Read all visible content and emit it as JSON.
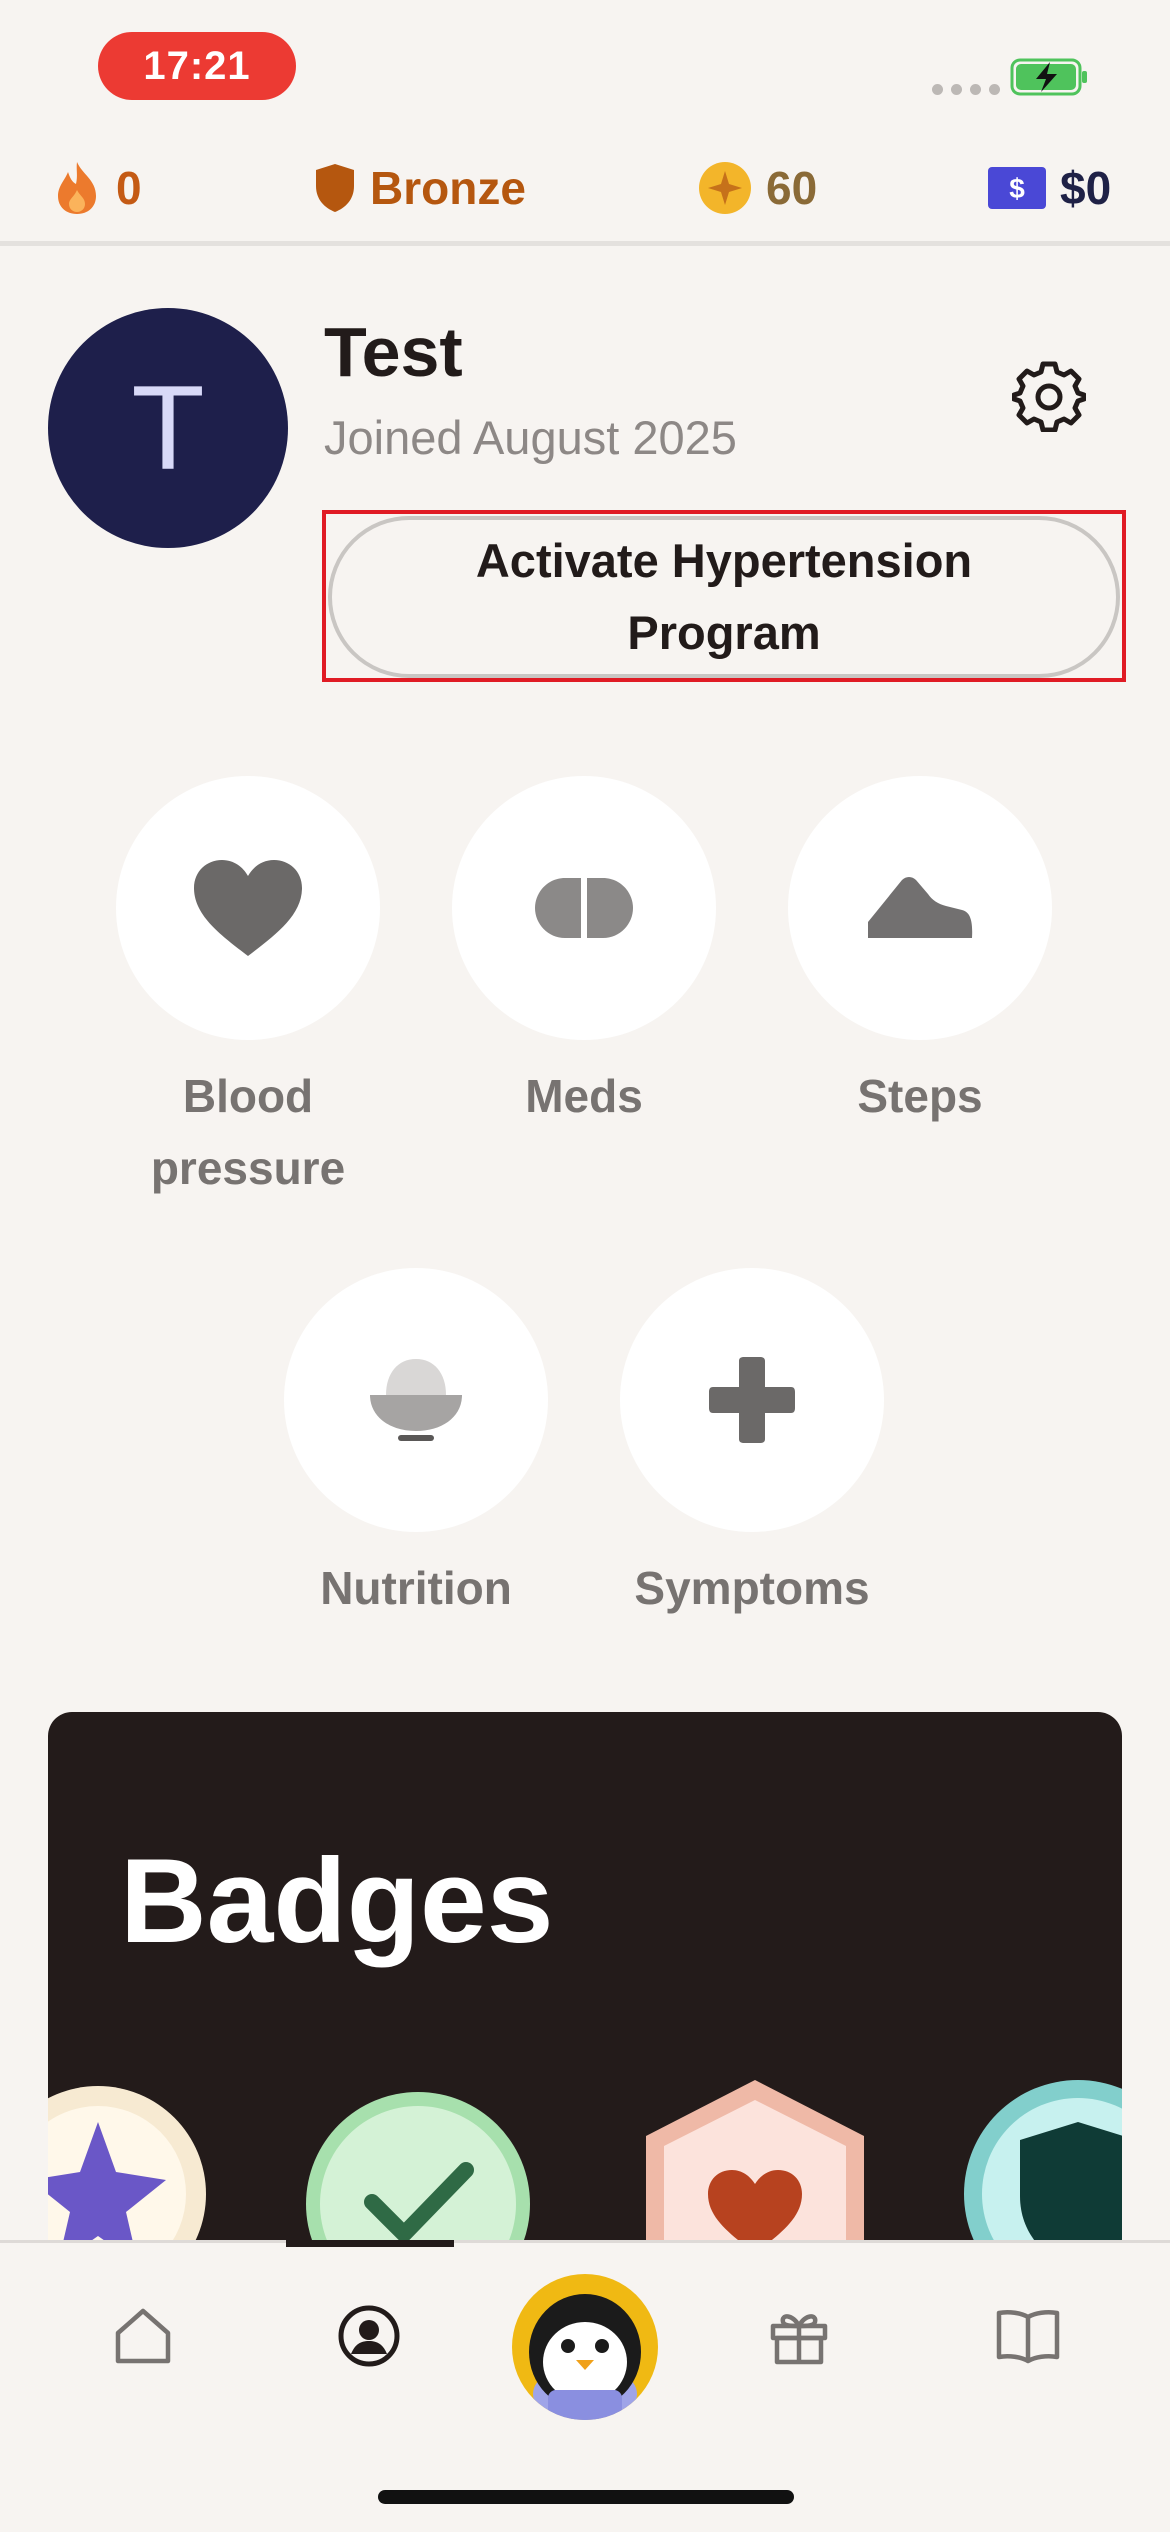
{
  "status_bar": {
    "time": "17:21",
    "icons": [
      "signal-dots-icon",
      "battery-charging-icon"
    ]
  },
  "stats": {
    "streak": "0",
    "league": "Bronze",
    "gems": "60",
    "cash": "$0",
    "cash_symbol": "$"
  },
  "profile": {
    "avatar_initial": "T",
    "name": "Test",
    "joined": "Joined August 2025",
    "activate_button": "Activate Hypertension Program"
  },
  "trackers": [
    {
      "label": "Blood pressure",
      "icon": "heart-icon"
    },
    {
      "label": "Meds",
      "icon": "pill-icon"
    },
    {
      "label": "Steps",
      "icon": "shoe-icon"
    },
    {
      "label": "Nutrition",
      "icon": "bowl-icon"
    },
    {
      "label": "Symptoms",
      "icon": "plus-icon"
    }
  ],
  "badges": {
    "title": "Badges"
  },
  "nav": {
    "items": [
      "home-icon",
      "profile-icon",
      "mascot-icon",
      "gift-icon",
      "book-icon"
    ],
    "active": "profile"
  },
  "colors": {
    "background": "#f7f4f1",
    "avatar": "#1e1f4b",
    "badges_card": "#231b1a",
    "streak": "#c45a14",
    "league": "#b5570f",
    "gems": "#8a6a37",
    "cash": "#1f2146",
    "highlight": "#e01b24"
  }
}
